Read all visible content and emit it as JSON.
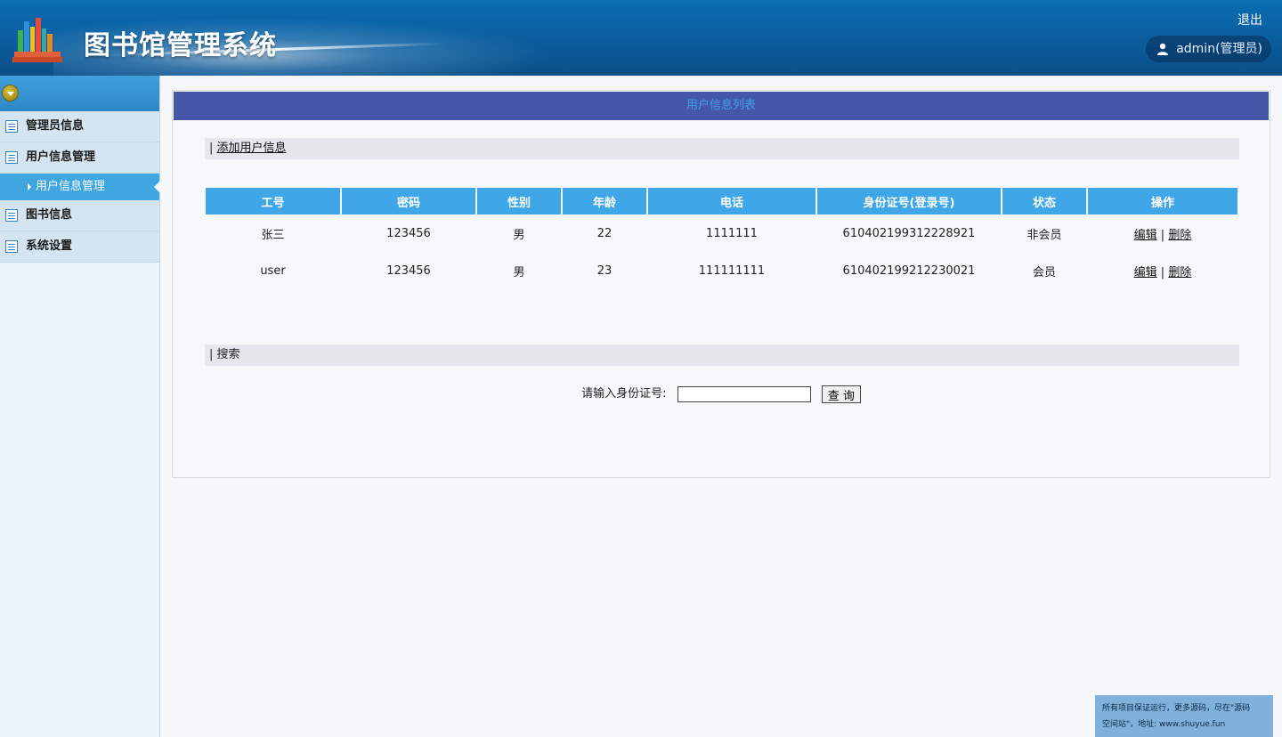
{
  "header": {
    "app_title": "图书馆管理系统",
    "logout_label": "退出",
    "user_label": "admin(管理员)"
  },
  "sidebar": {
    "items": [
      {
        "label": "管理员信息"
      },
      {
        "label": "用户信息管理"
      },
      {
        "label": "用户信息管理",
        "sub": true,
        "active": true
      },
      {
        "label": "图书信息"
      },
      {
        "label": "系统设置"
      }
    ]
  },
  "main": {
    "panel_title": "用户信息列表",
    "add_link": "添加用户信息",
    "columns": [
      "工号",
      "密码",
      "性别",
      "年龄",
      "电话",
      "身份证号(登录号)",
      "状态",
      "操作"
    ],
    "rows": [
      {
        "id": "张三",
        "password": "123456",
        "gender": "男",
        "age": "22",
        "phone": "1111111",
        "id_card": "610402199312228921",
        "status": "非会员",
        "edit": "编辑",
        "delete": "删除"
      },
      {
        "id": "user",
        "password": "123456",
        "gender": "男",
        "age": "23",
        "phone": "111111111",
        "id_card": "610402199212230021",
        "status": "会员",
        "edit": "编辑",
        "delete": "删除"
      }
    ],
    "search_section": "搜索",
    "search_label": "请输入身份证号:",
    "search_value": "",
    "search_button": "查 询"
  },
  "watermark": {
    "line1": "所有项目保证运行，更多源码，尽在\"源码",
    "line2": "空间站\"，地址: www.shuyue.fun"
  },
  "colors": {
    "header": "#0a5d9c",
    "panel_title_bg": "#4657a9",
    "table_header": "#3fa6e8",
    "active_menu": "#3fa6e0"
  }
}
